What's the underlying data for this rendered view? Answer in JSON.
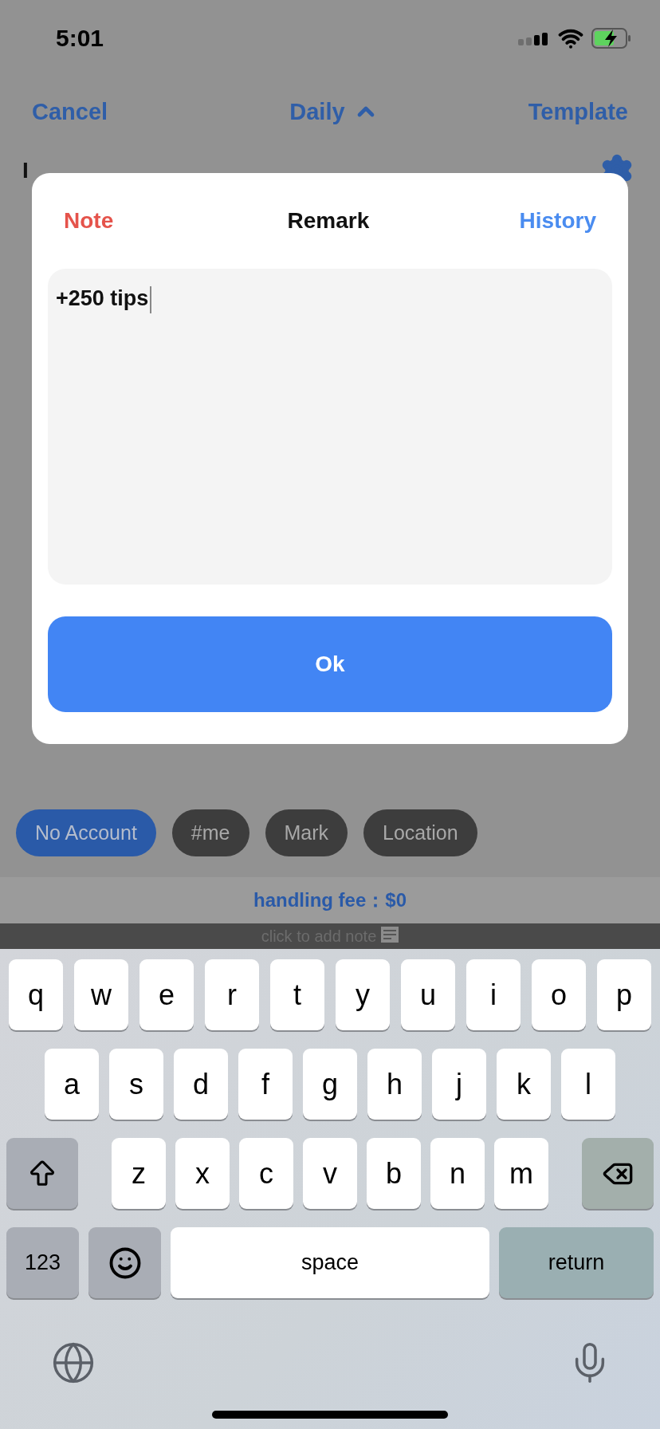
{
  "status_bar": {
    "time": "5:01"
  },
  "nav": {
    "left": "Cancel",
    "title": "Daily",
    "right": "Template"
  },
  "background_label": "I",
  "dialog": {
    "left": "Note",
    "title": "Remark",
    "right": "History",
    "field_value": "+250 tips",
    "button": "Ok"
  },
  "tags": [
    {
      "label": "No Account",
      "selected": true
    },
    {
      "label": "#me",
      "selected": false
    },
    {
      "label": "Mark",
      "selected": false
    },
    {
      "label": "Location",
      "selected": false
    }
  ],
  "fee": "handling fee：$0",
  "note_prompt": "click to add note",
  "keyboard": {
    "top_letters": [
      "q",
      "w",
      "e",
      "r",
      "t",
      "y",
      "u",
      "i",
      "o",
      "p"
    ],
    "middle_letters": [
      "a",
      "s",
      "d",
      "f",
      "g",
      "h",
      "j",
      "k",
      "l"
    ],
    "bottom_letters": [
      "z",
      "x",
      "c",
      "v",
      "b",
      "n",
      "m"
    ],
    "numbers_key": "123",
    "space_key": "space",
    "return_key": "return"
  }
}
